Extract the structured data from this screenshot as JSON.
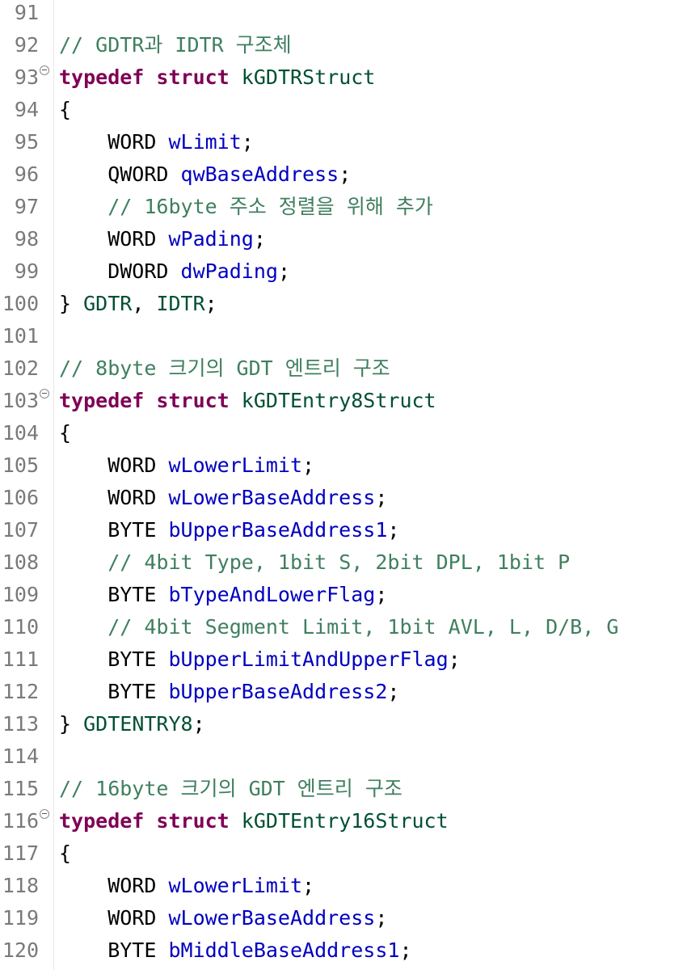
{
  "editor": {
    "lines": [
      {
        "num": "91",
        "fold": false,
        "tokens": []
      },
      {
        "num": "92",
        "fold": false,
        "tokens": [
          {
            "t": "// GDTR과 IDTR 구조체",
            "c": "cm"
          }
        ]
      },
      {
        "num": "93",
        "fold": true,
        "tokens": [
          {
            "t": "typedef",
            "c": "kw"
          },
          {
            "t": " ",
            "c": "pl"
          },
          {
            "t": "struct",
            "c": "kw"
          },
          {
            "t": " kGDTRStruct",
            "c": "tp"
          }
        ]
      },
      {
        "num": "94",
        "fold": false,
        "tokens": [
          {
            "t": "{",
            "c": "pl"
          }
        ]
      },
      {
        "num": "95",
        "fold": false,
        "tokens": [
          {
            "t": "    WORD ",
            "c": "pl"
          },
          {
            "t": "wLimit",
            "c": "fld"
          },
          {
            "t": ";",
            "c": "pl"
          }
        ]
      },
      {
        "num": "96",
        "fold": false,
        "tokens": [
          {
            "t": "    QWORD ",
            "c": "pl"
          },
          {
            "t": "qwBaseAddress",
            "c": "fld"
          },
          {
            "t": ";",
            "c": "pl"
          }
        ]
      },
      {
        "num": "97",
        "fold": false,
        "tokens": [
          {
            "t": "    ",
            "c": "pl"
          },
          {
            "t": "// 16byte 주소 정렬을 위해 추가",
            "c": "cm"
          }
        ]
      },
      {
        "num": "98",
        "fold": false,
        "tokens": [
          {
            "t": "    WORD ",
            "c": "pl"
          },
          {
            "t": "wPading",
            "c": "fld"
          },
          {
            "t": ";",
            "c": "pl"
          }
        ]
      },
      {
        "num": "99",
        "fold": false,
        "tokens": [
          {
            "t": "    DWORD ",
            "c": "pl"
          },
          {
            "t": "dwPading",
            "c": "fld"
          },
          {
            "t": ";",
            "c": "pl"
          }
        ]
      },
      {
        "num": "100",
        "fold": false,
        "tokens": [
          {
            "t": "} ",
            "c": "pl"
          },
          {
            "t": "GDTR",
            "c": "tp"
          },
          {
            "t": ", ",
            "c": "pl"
          },
          {
            "t": "IDTR",
            "c": "tp"
          },
          {
            "t": ";",
            "c": "pl"
          }
        ]
      },
      {
        "num": "101",
        "fold": false,
        "tokens": []
      },
      {
        "num": "102",
        "fold": false,
        "tokens": [
          {
            "t": "// 8byte 크기의 GDT 엔트리 구조",
            "c": "cm"
          }
        ]
      },
      {
        "num": "103",
        "fold": true,
        "tokens": [
          {
            "t": "typedef",
            "c": "kw"
          },
          {
            "t": " ",
            "c": "pl"
          },
          {
            "t": "struct",
            "c": "kw"
          },
          {
            "t": " kGDTEntry8Struct",
            "c": "tp"
          }
        ]
      },
      {
        "num": "104",
        "fold": false,
        "tokens": [
          {
            "t": "{",
            "c": "pl"
          }
        ]
      },
      {
        "num": "105",
        "fold": false,
        "tokens": [
          {
            "t": "    WORD ",
            "c": "pl"
          },
          {
            "t": "wLowerLimit",
            "c": "fld"
          },
          {
            "t": ";",
            "c": "pl"
          }
        ]
      },
      {
        "num": "106",
        "fold": false,
        "tokens": [
          {
            "t": "    WORD ",
            "c": "pl"
          },
          {
            "t": "wLowerBaseAddress",
            "c": "fld"
          },
          {
            "t": ";",
            "c": "pl"
          }
        ]
      },
      {
        "num": "107",
        "fold": false,
        "tokens": [
          {
            "t": "    BYTE ",
            "c": "pl"
          },
          {
            "t": "bUpperBaseAddress1",
            "c": "fld"
          },
          {
            "t": ";",
            "c": "pl"
          }
        ]
      },
      {
        "num": "108",
        "fold": false,
        "tokens": [
          {
            "t": "    ",
            "c": "pl"
          },
          {
            "t": "// 4bit Type, 1bit S, 2bit DPL, 1bit P",
            "c": "cm"
          }
        ]
      },
      {
        "num": "109",
        "fold": false,
        "tokens": [
          {
            "t": "    BYTE ",
            "c": "pl"
          },
          {
            "t": "bTypeAndLowerFlag",
            "c": "fld"
          },
          {
            "t": ";",
            "c": "pl"
          }
        ]
      },
      {
        "num": "110",
        "fold": false,
        "tokens": [
          {
            "t": "    ",
            "c": "pl"
          },
          {
            "t": "// 4bit Segment Limit, 1bit AVL, L, D/B, G",
            "c": "cm"
          }
        ]
      },
      {
        "num": "111",
        "fold": false,
        "tokens": [
          {
            "t": "    BYTE ",
            "c": "pl"
          },
          {
            "t": "bUpperLimitAndUpperFlag",
            "c": "fld"
          },
          {
            "t": ";",
            "c": "pl"
          }
        ]
      },
      {
        "num": "112",
        "fold": false,
        "tokens": [
          {
            "t": "    BYTE ",
            "c": "pl"
          },
          {
            "t": "bUpperBaseAddress2",
            "c": "fld"
          },
          {
            "t": ";",
            "c": "pl"
          }
        ]
      },
      {
        "num": "113",
        "fold": false,
        "tokens": [
          {
            "t": "} ",
            "c": "pl"
          },
          {
            "t": "GDTENTRY8",
            "c": "tp"
          },
          {
            "t": ";",
            "c": "pl"
          }
        ]
      },
      {
        "num": "114",
        "fold": false,
        "tokens": []
      },
      {
        "num": "115",
        "fold": false,
        "tokens": [
          {
            "t": "// 16byte 크기의 GDT 엔트리 구조",
            "c": "cm"
          }
        ]
      },
      {
        "num": "116",
        "fold": true,
        "tokens": [
          {
            "t": "typedef",
            "c": "kw"
          },
          {
            "t": " ",
            "c": "pl"
          },
          {
            "t": "struct",
            "c": "kw"
          },
          {
            "t": " kGDTEntry16Struct",
            "c": "tp"
          }
        ]
      },
      {
        "num": "117",
        "fold": false,
        "tokens": [
          {
            "t": "{",
            "c": "pl"
          }
        ]
      },
      {
        "num": "118",
        "fold": false,
        "tokens": [
          {
            "t": "    WORD ",
            "c": "pl"
          },
          {
            "t": "wLowerLimit",
            "c": "fld"
          },
          {
            "t": ";",
            "c": "pl"
          }
        ]
      },
      {
        "num": "119",
        "fold": false,
        "tokens": [
          {
            "t": "    WORD ",
            "c": "pl"
          },
          {
            "t": "wLowerBaseAddress",
            "c": "fld"
          },
          {
            "t": ";",
            "c": "pl"
          }
        ]
      },
      {
        "num": "120",
        "fold": false,
        "tokens": [
          {
            "t": "    BYTE ",
            "c": "pl"
          },
          {
            "t": "bMiddleBaseAddress1",
            "c": "fld"
          },
          {
            "t": ";",
            "c": "pl"
          }
        ]
      }
    ]
  },
  "colors": {
    "keyword": "#7f0055",
    "type_name": "#005032",
    "field": "#0000c0",
    "comment": "#3f7f5f",
    "line_number": "#7a7a7a",
    "text": "#000000"
  }
}
